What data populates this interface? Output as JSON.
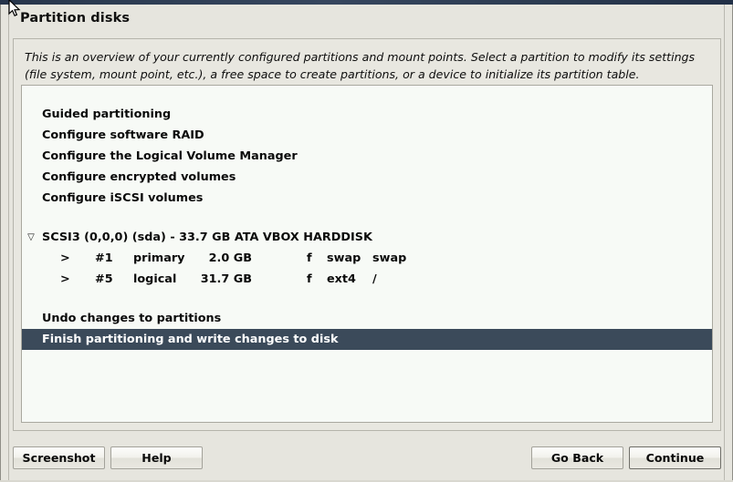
{
  "window": {
    "title": "Partition disks"
  },
  "description": "This is an overview of your currently configured partitions and mount points. Select a partition to modify its settings (file system, mount point, etc.), a free space to create partitions, or a device to initialize its partition table.",
  "colors": {
    "dialog_background": "#e6e5de",
    "listbox_background": "#f7faf6",
    "selection_background": "#3b4a5a",
    "selection_text": "#ffffff",
    "titlebar": "#2c3b51"
  },
  "list": {
    "menu_items": [
      {
        "label": "Guided partitioning"
      },
      {
        "label": "Configure software RAID"
      },
      {
        "label": "Configure the Logical Volume Manager"
      },
      {
        "label": "Configure encrypted volumes"
      },
      {
        "label": "Configure iSCSI volumes"
      }
    ],
    "disk": {
      "expander": "▽",
      "label": "SCSI3 (0,0,0) (sda) - 33.7 GB ATA VBOX HARDDISK",
      "partitions": [
        {
          "arrow": ">",
          "number": "#1",
          "type": "primary",
          "size": "2.0 GB",
          "flag": "f",
          "filesystem": "swap",
          "mountpoint": "swap"
        },
        {
          "arrow": ">",
          "number": "#5",
          "type": "logical",
          "size": "31.7 GB",
          "flag": "f",
          "filesystem": "ext4",
          "mountpoint": "/"
        }
      ]
    },
    "actions": [
      {
        "label": "Undo changes to partitions",
        "selected": false
      },
      {
        "label": "Finish partitioning and write changes to disk",
        "selected": true
      }
    ]
  },
  "buttons": {
    "screenshot": "Screenshot",
    "help": "Help",
    "go_back": "Go Back",
    "continue": "Continue"
  }
}
